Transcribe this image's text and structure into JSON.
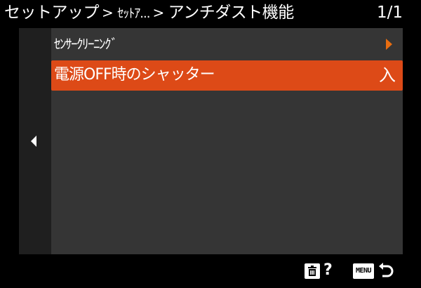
{
  "header": {
    "breadcrumb_1": "セットアップ",
    "breadcrumb_2": "ｾｯﾄｱ...",
    "breadcrumb_3": "アンチダスト機能",
    "separator": ">",
    "page": "1/1"
  },
  "menu": {
    "items": [
      {
        "label": "ｾﾝｻｰｸﾘｰﾆﾝｸﾞ",
        "value": ""
      },
      {
        "label": "電源OFF時のシャッター",
        "value": "入"
      }
    ]
  },
  "footer": {
    "menu_label": "MENU",
    "help_glyph": "?"
  },
  "icons": {
    "left": "left-arrow-icon",
    "right": "right-arrow-icon",
    "trash": "trash-icon",
    "help": "help-icon",
    "back": "back-icon"
  },
  "colors": {
    "accent": "#dd4a17",
    "arrow": "#e86d11",
    "panel": "#353535",
    "rail": "#1f1f1f"
  }
}
